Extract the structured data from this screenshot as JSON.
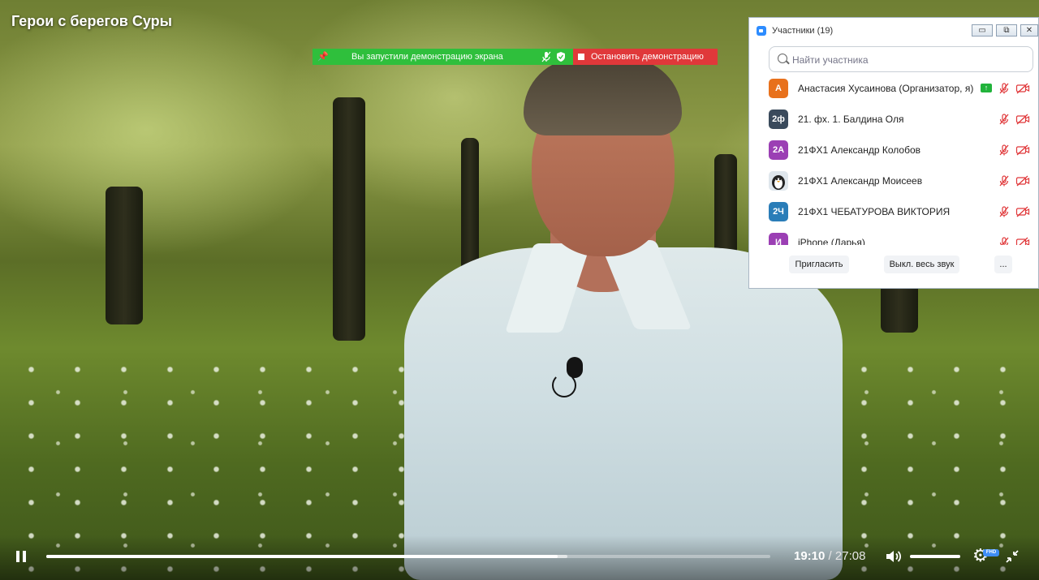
{
  "video": {
    "title": "Герои с берегов Суры"
  },
  "sharing_bar": {
    "status_text": "Вы запустили демонстрацию экрана",
    "stop_label": "Остановить демонстрацию",
    "status_color": "#2fbf3c",
    "stop_color": "#e0383a"
  },
  "participants_panel": {
    "title": "Участники (19)",
    "search_placeholder": "Найти участника",
    "participants": [
      {
        "initials": "А",
        "name": "Анастасия Хусаинова (Организатор, я)",
        "avatar_color": "#e8711c",
        "sharing": true
      },
      {
        "initials": "2ф",
        "name": "21. фх. 1. Балдина Оля",
        "avatar_color": "#3a4a5c",
        "sharing": false
      },
      {
        "initials": "2А",
        "name": "21ФХ1 Александр Колобов",
        "avatar_color": "#9b3fb4",
        "sharing": false
      },
      {
        "initials": "",
        "name": "21ФХ1 Александр Моисеев",
        "avatar_color": "#dfe6ec",
        "sharing": false,
        "avatar_icon": "penguin-avatar-icon"
      },
      {
        "initials": "2Ч",
        "name": "21ФХ1 ЧЕБАТУРОВА ВИКТОРИЯ",
        "avatar_color": "#2a7db8",
        "sharing": false
      },
      {
        "initials": "И",
        "name": "iPhone (Дарья)",
        "avatar_color": "#9b3fb4",
        "sharing": false
      }
    ],
    "footer": {
      "invite_label": "Пригласить",
      "mute_all_label": "Выкл. весь звук",
      "more_label": "..."
    },
    "window_buttons": {
      "minimize": "▭",
      "restore": "⧉",
      "close": "✕"
    }
  },
  "player": {
    "current_time": "19:10",
    "separator": " / ",
    "duration": "27:08",
    "progress_fraction": 0.706,
    "buffered_fraction": 0.72,
    "volume_fraction": 1.0,
    "quality_badge": "FHD"
  }
}
